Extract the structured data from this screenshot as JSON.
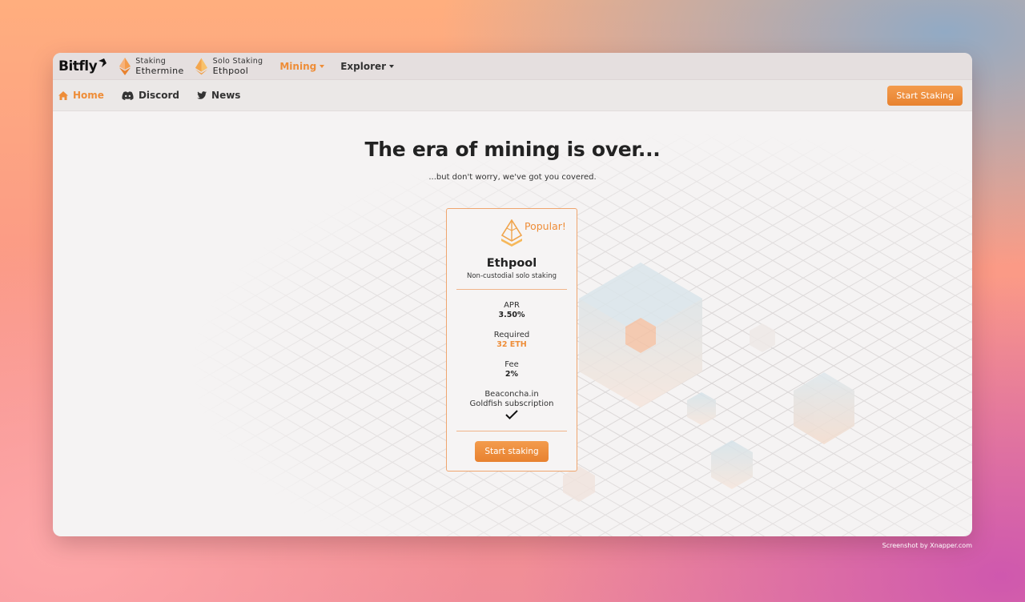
{
  "brand": {
    "logo_text": "Bitfly"
  },
  "topbar": {
    "pools": [
      {
        "small": "Staking",
        "big": "Ethermine"
      },
      {
        "small": "Solo Staking",
        "big": "Ethpool"
      }
    ],
    "menus": [
      {
        "label": "Mining",
        "active": true
      },
      {
        "label": "Explorer",
        "active": false
      }
    ]
  },
  "subnav": {
    "items": [
      {
        "label": "Home",
        "icon": "home-icon"
      },
      {
        "label": "Discord",
        "icon": "discord-icon"
      },
      {
        "label": "News",
        "icon": "twitter-icon"
      }
    ],
    "cta": "Start Staking"
  },
  "hero": {
    "title": "The era of mining is over...",
    "subtitle": "...but don't worry, we've got you covered."
  },
  "card": {
    "badge": "Popular!",
    "title": "Ethpool",
    "description": "Non-custodial solo staking",
    "stats": [
      {
        "label": "APR",
        "value": "3.50%"
      },
      {
        "label": "Required",
        "value": "32 ETH"
      },
      {
        "label": "Fee",
        "value": "2%"
      }
    ],
    "feature": "Beaconcha.in Goldfish subscription",
    "button": "Start staking"
  },
  "footnote": "Screenshot by Xnapper.com",
  "colors": {
    "accent": "#ee8d38",
    "text": "#222222"
  }
}
